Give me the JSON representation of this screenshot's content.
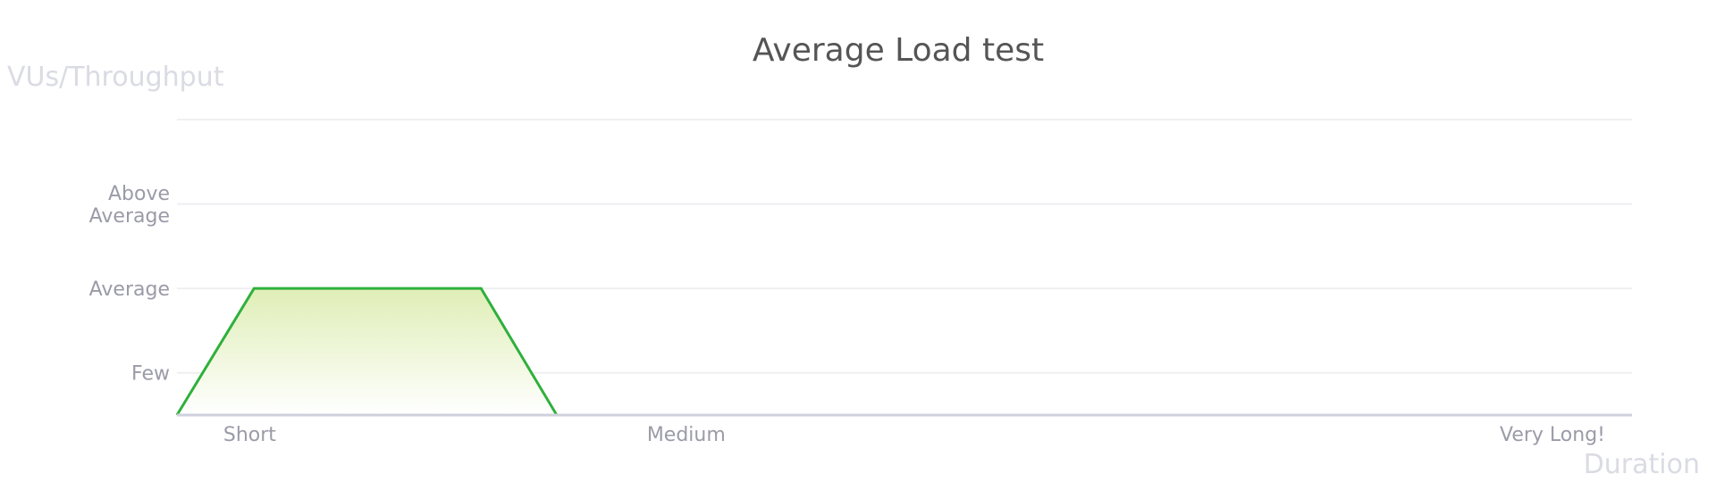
{
  "chart_data": {
    "type": "area",
    "title": "Average Load test",
    "ylabel": "VUs/Throughput",
    "xlabel": "Duration",
    "y_ticks": [
      {
        "value": 1,
        "label": [
          "Few"
        ]
      },
      {
        "value": 2,
        "label": [
          "Average"
        ]
      },
      {
        "value": 3,
        "label": [
          "Above",
          "Average"
        ]
      },
      {
        "value": 4,
        "label": []
      }
    ],
    "x_ticks": [
      {
        "value": 0.5,
        "label": "Short"
      },
      {
        "value": 3.5,
        "label": "Medium"
      },
      {
        "value": 10,
        "label": "Very Long!"
      }
    ],
    "xlim": [
      0,
      10
    ],
    "ylim": [
      0.5,
      4
    ],
    "series": [
      {
        "x": [
          0,
          0.53,
          2.09,
          2.61
        ],
        "y": [
          0.5,
          2,
          2,
          0.5
        ]
      }
    ],
    "grid": true,
    "colors": {
      "line": "#2fb03c",
      "fill_top": "#dfeeb6",
      "fill_bottom": "#ffffff"
    }
  }
}
